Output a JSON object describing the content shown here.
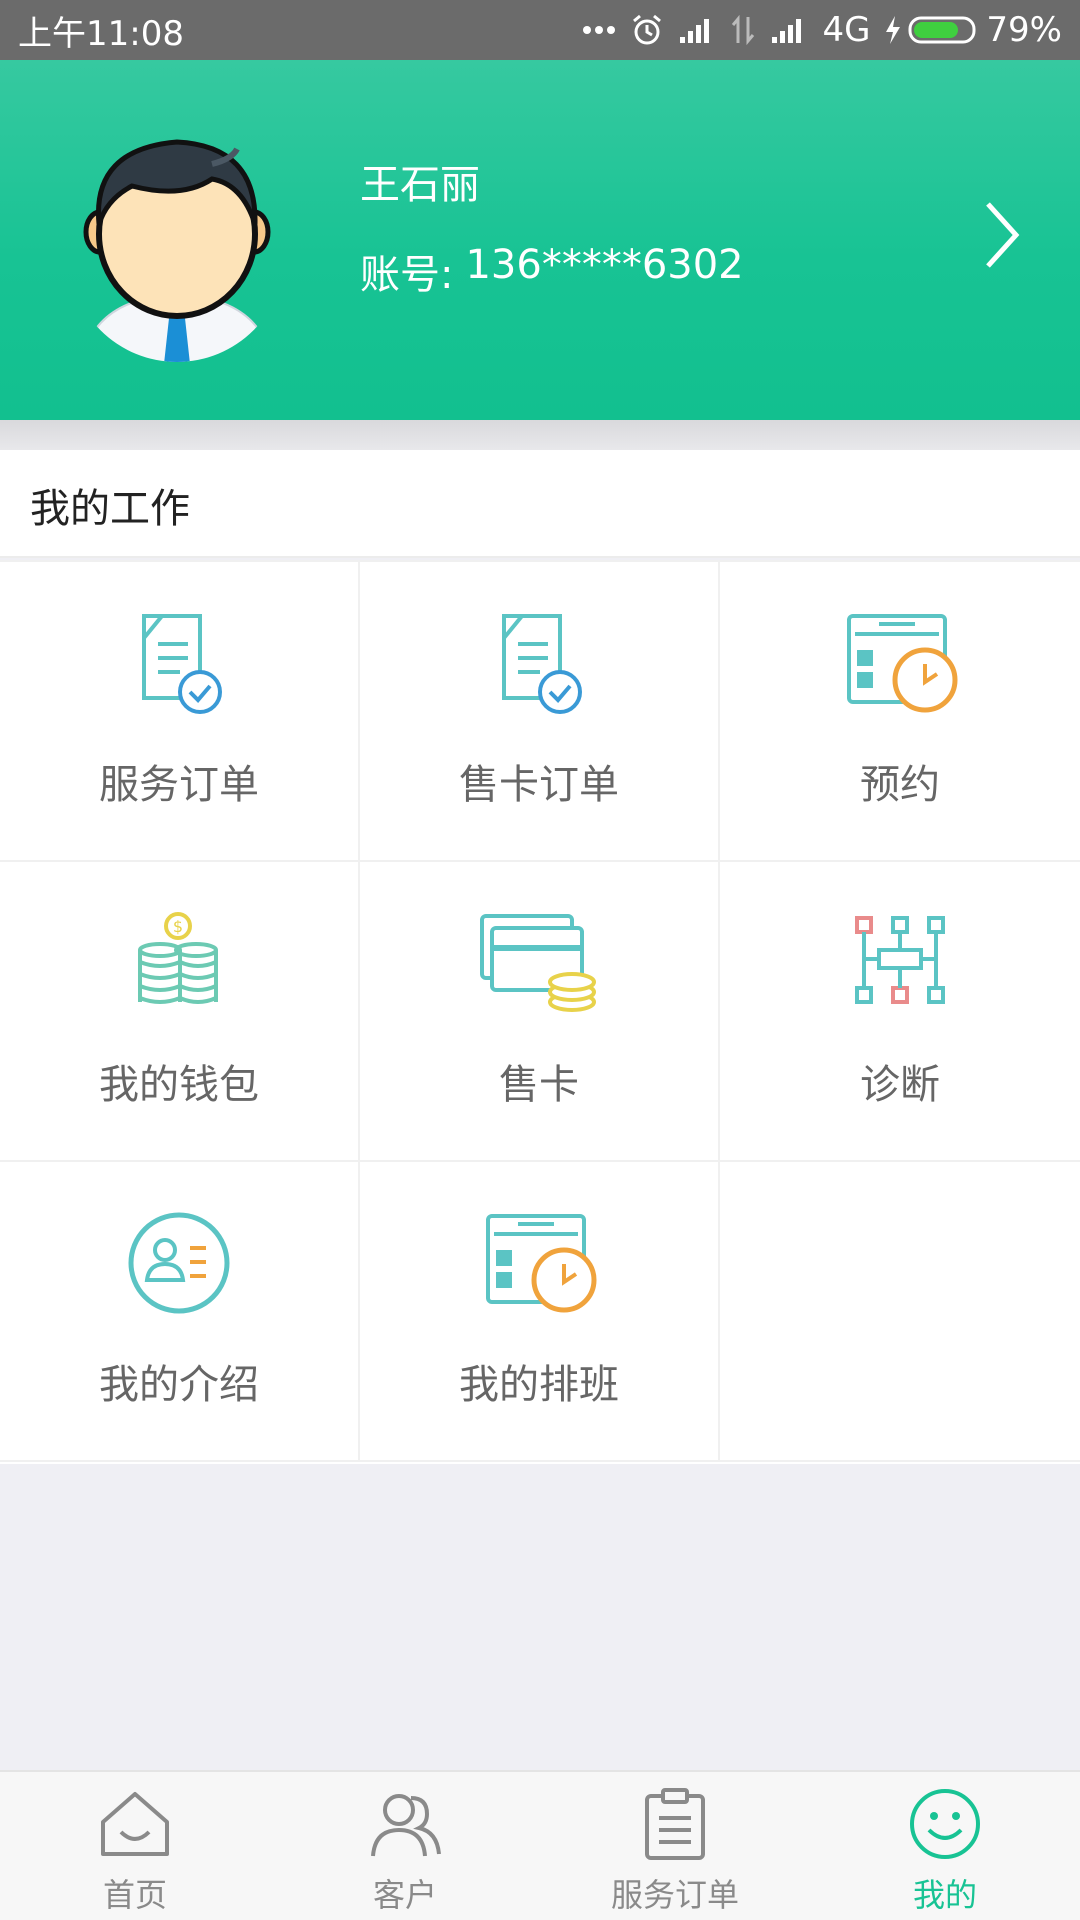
{
  "status_bar": {
    "time": "上午11:08",
    "network": "4G",
    "battery": "79%",
    "battery_level": 0.79
  },
  "profile": {
    "name": "王石丽",
    "account_label": "账号:",
    "account_number": "136*****6302"
  },
  "work_section": {
    "title": "我的工作",
    "items": [
      {
        "label": "服务订单",
        "icon": "document-check-icon"
      },
      {
        "label": "售卡订单",
        "icon": "document-check-icon"
      },
      {
        "label": "预约",
        "icon": "calendar-clock-icon"
      },
      {
        "label": "我的钱包",
        "icon": "coins-icon"
      },
      {
        "label": "售卡",
        "icon": "cards-coins-icon"
      },
      {
        "label": "诊断",
        "icon": "diagram-icon"
      },
      {
        "label": "我的介绍",
        "icon": "profile-card-icon"
      },
      {
        "label": "我的排班",
        "icon": "calendar-clock-icon"
      }
    ]
  },
  "tab_bar": {
    "tabs": [
      {
        "label": "首页",
        "icon": "home-icon"
      },
      {
        "label": "客户",
        "icon": "users-icon"
      },
      {
        "label": "服务订单",
        "icon": "clipboard-icon"
      },
      {
        "label": "我的",
        "icon": "smile-icon"
      }
    ],
    "active_index": 3
  },
  "colors": {
    "accent": "#18c394",
    "teal_icon": "#5bc4c4",
    "orange_icon": "#f0a33c",
    "blue_check": "#3a9ad6",
    "coin_yellow": "#e8d24a"
  }
}
